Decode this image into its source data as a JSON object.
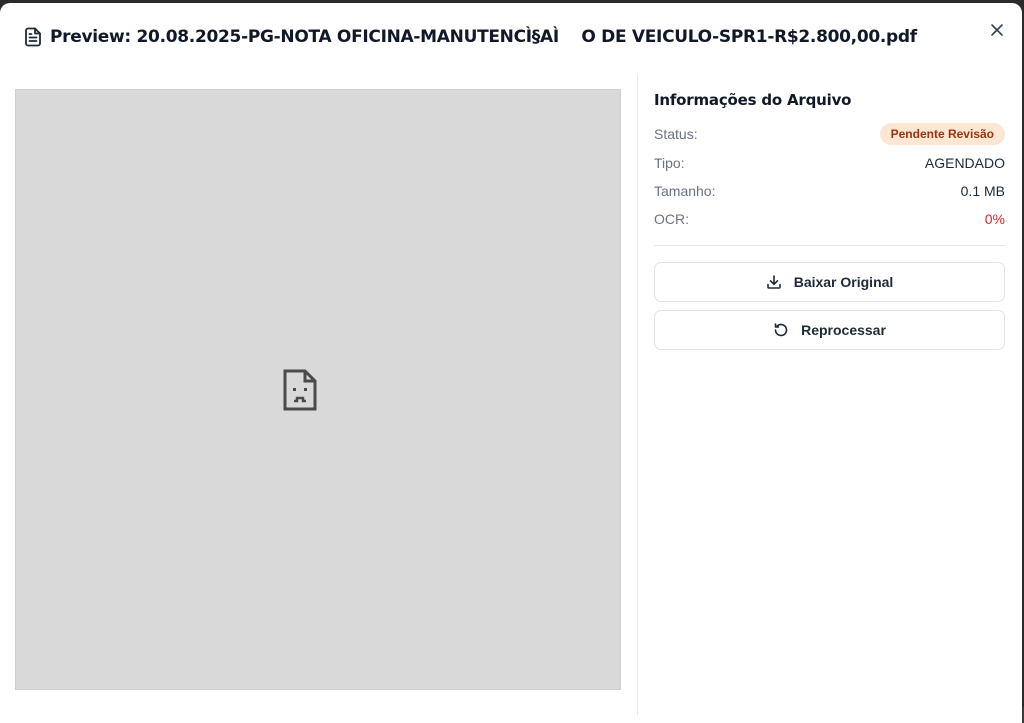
{
  "dialog": {
    "title": "Preview: 20.08.2025-PG-NOTA OFICINA-MANUTENCÌ§AÌ    O DE VEICULO-SPR1-R$2.800,00.pdf"
  },
  "info": {
    "heading": "Informações do Arquivo",
    "status_label": "Status:",
    "status_value": "Pendente Revisão",
    "type_label": "Tipo:",
    "type_value": "AGENDADO",
    "size_label": "Tamanho:",
    "size_value": "0.1 MB",
    "ocr_label": "OCR:",
    "ocr_value": "0%"
  },
  "actions": {
    "download_label": "Baixar Original",
    "reprocess_label": "Reprocessar"
  },
  "colors": {
    "status_badge_bg": "#fde7d3",
    "status_badge_text": "#9a3412",
    "ocr_value": "#dc2626"
  }
}
